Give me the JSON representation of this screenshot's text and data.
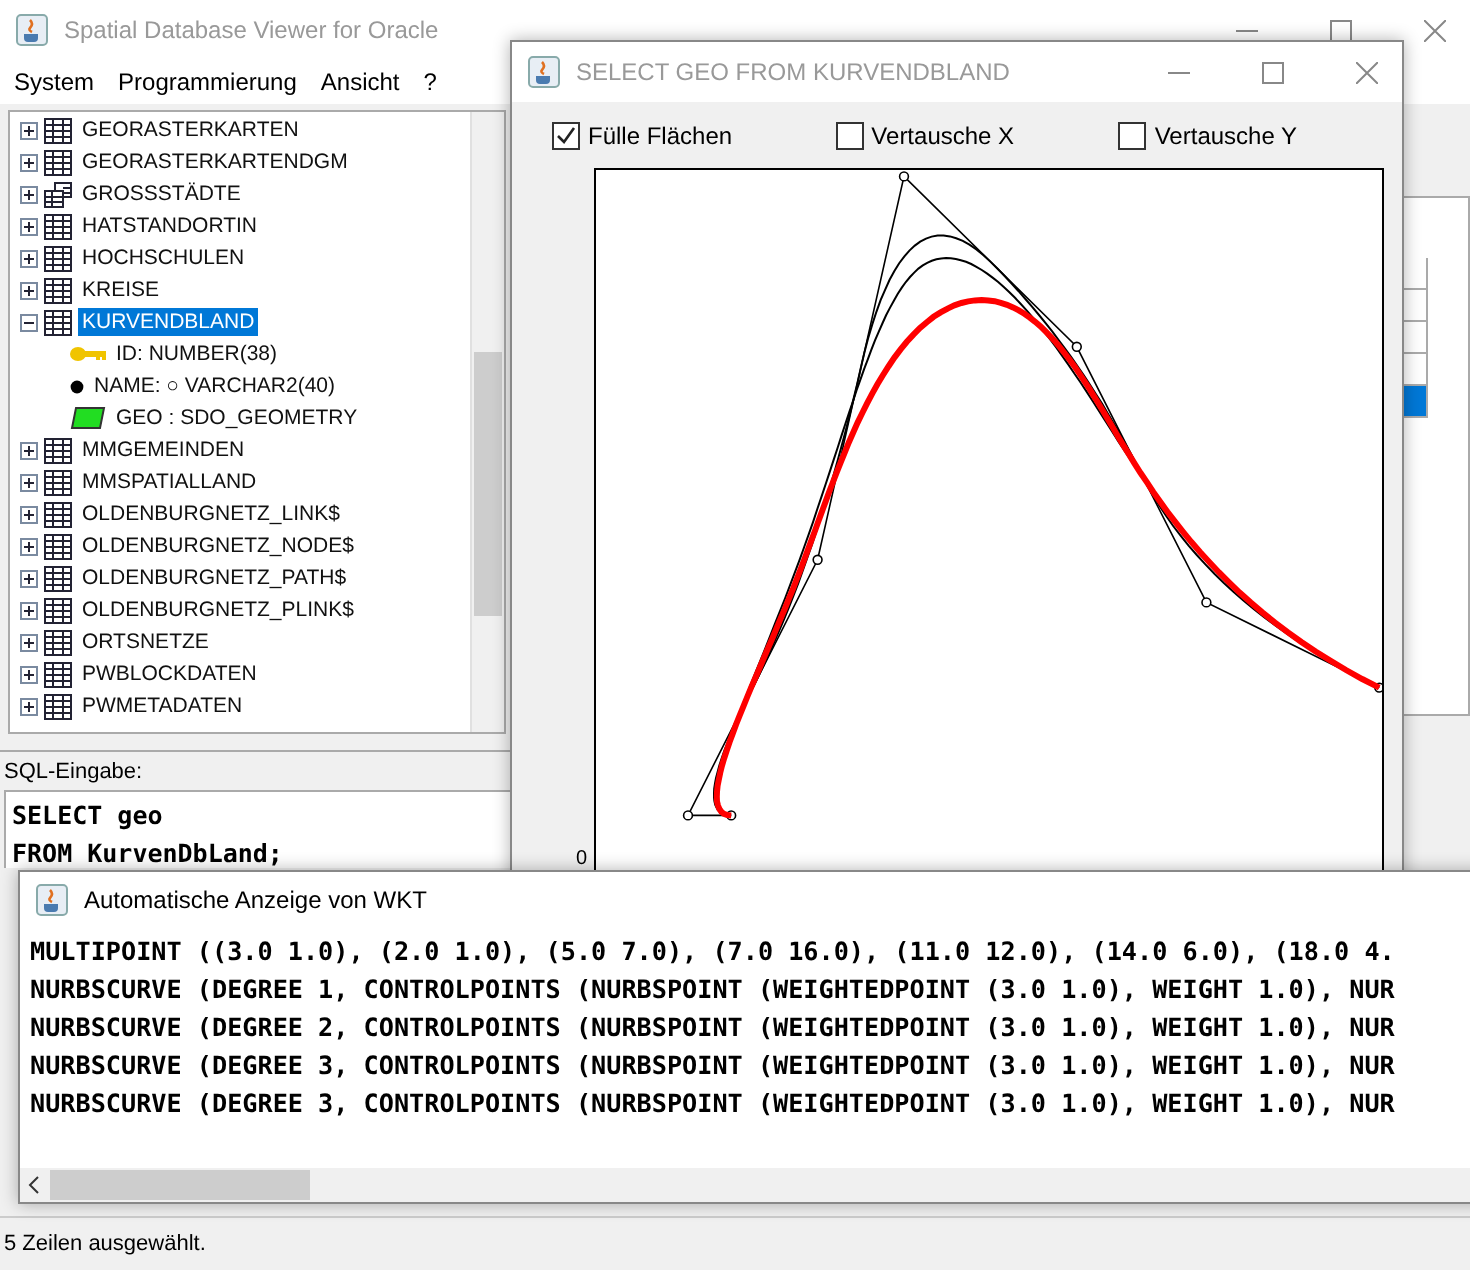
{
  "main_window": {
    "title": "Spatial Database Viewer for Oracle",
    "menu": [
      "System",
      "Programmierung",
      "Ansicht",
      "?"
    ]
  },
  "tree": [
    {
      "label": "GEORASTERKARTEN",
      "kind": "table",
      "expanded": false,
      "selected": false
    },
    {
      "label": "GEORASTERKARTENDGM",
      "kind": "table",
      "expanded": false,
      "selected": false
    },
    {
      "label": "GROSSSTÄDTE",
      "kind": "view",
      "expanded": false,
      "selected": false
    },
    {
      "label": "HATSTANDORTIN",
      "kind": "table",
      "expanded": false,
      "selected": false
    },
    {
      "label": "HOCHSCHULEN",
      "kind": "table",
      "expanded": false,
      "selected": false
    },
    {
      "label": "KREISE",
      "kind": "table",
      "expanded": false,
      "selected": false
    },
    {
      "label": "KURVENDBLAND",
      "kind": "table",
      "expanded": true,
      "selected": true,
      "children": [
        {
          "label": "ID: NUMBER(38)",
          "kind": "key"
        },
        {
          "label": "NAME: ○ VARCHAR2(40)",
          "kind": "column"
        },
        {
          "label": "GEO : SDO_GEOMETRY",
          "kind": "geometry"
        }
      ]
    },
    {
      "label": "MMGEMEINDEN",
      "kind": "table",
      "expanded": false,
      "selected": false
    },
    {
      "label": "MMSPATIALLAND",
      "kind": "table",
      "expanded": false,
      "selected": false
    },
    {
      "label": "OLDENBURGNETZ_LINK$",
      "kind": "table",
      "expanded": false,
      "selected": false
    },
    {
      "label": "OLDENBURGNETZ_NODE$",
      "kind": "table",
      "expanded": false,
      "selected": false
    },
    {
      "label": "OLDENBURGNETZ_PATH$",
      "kind": "table",
      "expanded": false,
      "selected": false
    },
    {
      "label": "OLDENBURGNETZ_PLINK$",
      "kind": "table",
      "expanded": false,
      "selected": false
    },
    {
      "label": "ORTSNETZE",
      "kind": "table",
      "expanded": false,
      "selected": false
    },
    {
      "label": "PWBLOCKDATEN",
      "kind": "table",
      "expanded": false,
      "selected": false
    },
    {
      "label": "PWMETADATEN",
      "kind": "table",
      "expanded": false,
      "selected": false
    }
  ],
  "sql": {
    "label": "SQL-Eingabe:",
    "lines": [
      "SELECT geo",
      "FROM KurvenDbLand;"
    ]
  },
  "result_rows": [
    {
      "selected": false
    },
    {
      "selected": false
    },
    {
      "selected": false
    },
    {
      "selected": false
    },
    {
      "selected": true
    }
  ],
  "status_bar": "5 Zeilen ausgewählt.",
  "geo_window": {
    "title": "SELECT GEO FROM KURVENDBLAND",
    "options": [
      {
        "label": "Fülle Flächen",
        "checked": true
      },
      {
        "label": "Vertausche X",
        "checked": false
      },
      {
        "label": "Vertausche Y",
        "checked": false
      }
    ],
    "axis_label": "0"
  },
  "wkt_window": {
    "title": "Automatische Anzeige von WKT",
    "lines": [
      "MULTIPOINT ((3.0 1.0), (2.0 1.0), (5.0 7.0), (7.0 16.0), (11.0 12.0), (14.0 6.0), (18.0 4.",
      "NURBSCURVE (DEGREE 1, CONTROLPOINTS (NURBSPOINT (WEIGHTEDPOINT (3.0 1.0), WEIGHT 1.0), NUR",
      "NURBSCURVE (DEGREE 2, CONTROLPOINTS (NURBSPOINT (WEIGHTEDPOINT (3.0 1.0), WEIGHT 1.0), NUR",
      "NURBSCURVE (DEGREE 3, CONTROLPOINTS (NURBSPOINT (WEIGHTEDPOINT (3.0 1.0), WEIGHT 1.0), NUR",
      "NURBSCURVE (DEGREE 3, CONTROLPOINTS (NURBSPOINT (WEIGHTEDPOINT (3.0 1.0), WEIGHT 1.0), NUR"
    ]
  }
}
